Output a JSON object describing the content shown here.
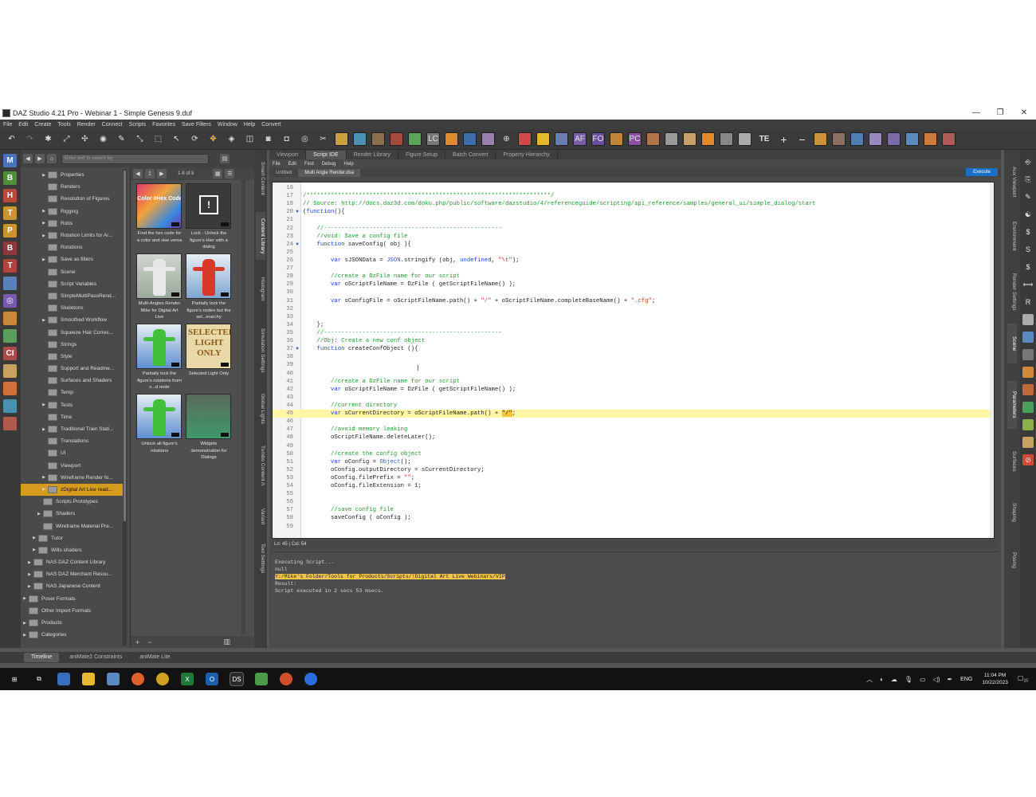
{
  "window": {
    "title": "DAZ Studio 4.21 Pro - Webinar 1 - Simple Genesis 9.duf"
  },
  "menu": [
    "File",
    "Edit",
    "Create",
    "Tools",
    "Render",
    "Connect",
    "Scripts",
    "Favorites",
    "Save Filters",
    "Window",
    "Help",
    "Convert"
  ],
  "toolbar_right": {
    "te_label": "TE"
  },
  "library": {
    "search_placeholder": "Enter text to search by",
    "page_label": "1",
    "count_label": "1-8 of 8",
    "tree": [
      {
        "label": "Properties",
        "arrow": "▶"
      },
      {
        "label": "Renders",
        "arrow": ""
      },
      {
        "label": "Resolution of Figures",
        "arrow": ""
      },
      {
        "label": "Rigging",
        "arrow": "▶"
      },
      {
        "label": "Robs",
        "arrow": "▶"
      },
      {
        "label": "Rotation Limits for Ar...",
        "arrow": "▶"
      },
      {
        "label": "Rotations",
        "arrow": ""
      },
      {
        "label": "Save as filters",
        "arrow": "▶"
      },
      {
        "label": "Scene",
        "arrow": ""
      },
      {
        "label": "Script Variables",
        "arrow": ""
      },
      {
        "label": "SimpleMultiPassRend...",
        "arrow": ""
      },
      {
        "label": "Skeletons",
        "arrow": ""
      },
      {
        "label": "Smoothed Workflow",
        "arrow": "▶"
      },
      {
        "label": "Squeeze Hair Correc...",
        "arrow": ""
      },
      {
        "label": "Strings",
        "arrow": ""
      },
      {
        "label": "Style",
        "arrow": ""
      },
      {
        "label": "Support and Readme...",
        "arrow": ""
      },
      {
        "label": "Surfaces and Shaders",
        "arrow": ""
      },
      {
        "label": "Temp",
        "arrow": ""
      },
      {
        "label": "Tests",
        "arrow": "▶"
      },
      {
        "label": "Time",
        "arrow": ""
      },
      {
        "label": "Traditional Train Stati...",
        "arrow": "▶"
      },
      {
        "label": "Translations",
        "arrow": ""
      },
      {
        "label": "UI",
        "arrow": ""
      },
      {
        "label": "Viewport",
        "arrow": ""
      },
      {
        "label": "Wireframe Render fo...",
        "arrow": "▶"
      },
      {
        "label": "zDigital Art Live read...",
        "arrow": "▶",
        "selected": true
      },
      {
        "label": "Scripts Prototypes",
        "arrow": ""
      },
      {
        "label": "Shaders",
        "arrow": "▶"
      },
      {
        "label": "Wireframe Material Pre...",
        "arrow": ""
      },
      {
        "label": "Tutor",
        "arrow": "▶"
      },
      {
        "label": "Wills shaders",
        "arrow": "▶"
      },
      {
        "label": "NAS DAZ Content Library",
        "arrow": "▶"
      },
      {
        "label": "NAS DAZ Merchant Resou...",
        "arrow": "▶"
      },
      {
        "label": "NAS Japanese Content",
        "arrow": "▶"
      },
      {
        "label": "Poser Formats",
        "arrow": "▶"
      },
      {
        "label": "Other Import Formats",
        "arrow": ""
      },
      {
        "label": "Products",
        "arrow": "▶"
      },
      {
        "label": "Categories",
        "arrow": "▶"
      }
    ],
    "tiles": [
      {
        "caption": "Find the hex code for a color and vise versa",
        "thumb_text": "Color #Hex Code",
        "kind": "hex"
      },
      {
        "caption": "Lock - Unlock the figure's Hier with a dialog",
        "thumb_text": "!",
        "kind": "lock"
      },
      {
        "caption": "Multi-Angles Render Mike for Digital Art Live",
        "thumb_text": "",
        "kind": "multi"
      },
      {
        "caption": "Partially lock the figure's nodes but the sel...erarchy",
        "thumb_text": "",
        "kind": "redfig"
      },
      {
        "caption": "Partially lock the figure's rotations from s...d node",
        "thumb_text": "",
        "kind": "greenfig"
      },
      {
        "caption": "Selected Light Only",
        "thumb_text": "SELECTED LIGHT ONLY",
        "kind": "light"
      },
      {
        "caption": "Unlock all figure's rotations",
        "thumb_text": "",
        "kind": "greenfig2"
      },
      {
        "caption": "Widgets demonstration for Dialogs",
        "thumb_text": "",
        "kind": "widgets"
      }
    ]
  },
  "side_tabs_left": [
    "Smart Content",
    "Content Library",
    "Histogram",
    "Simulation Settings",
    "Global Lights",
    "Tumbo Content A",
    "Variant",
    "Tool Settings"
  ],
  "side_tabs_right": [
    "Aux Viewport",
    "Environment",
    "Render Settings",
    "Scene",
    "Parameters",
    "Surfaces",
    "Shaping",
    "Posing"
  ],
  "view_tabs": [
    "Viewport",
    "Script IDE",
    "Render Library",
    "Figure Setup",
    "Batch Convert",
    "Property Hierarchy"
  ],
  "ide": {
    "menu": [
      "File",
      "Edit",
      "Find",
      "Debug",
      "Help"
    ],
    "file_tabs": [
      "Untitled",
      "Multi Angle Render.dsa"
    ],
    "execute_label": "Execute",
    "status": "Ln: 45  |  Col: 54",
    "lines": [
      {
        "n": "16",
        "t": ""
      },
      {
        "n": "17",
        "t": "/**********************************************************************/"
      },
      {
        "n": "18",
        "t": "// Source: http://docs.daz3d.com/doku.php/public/software/dazstudio/4/referenceguide/scripting/api_reference/samples/general_ui/simple_dialog/start"
      },
      {
        "n": "20",
        "t": "(function(){",
        "fold": "▼"
      },
      {
        "n": "21",
        "t": ""
      },
      {
        "n": "22",
        "t": "    //---------------------------------------------------"
      },
      {
        "n": "23",
        "t": "    //void: Save a config file"
      },
      {
        "n": "24",
        "t": "    function saveConfig( obj ){",
        "fold": "▼"
      },
      {
        "n": "25",
        "t": ""
      },
      {
        "n": "26",
        "t": "        var sJSONData = JSON.stringify (obj, undefined, \"\\t\");"
      },
      {
        "n": "27",
        "t": ""
      },
      {
        "n": "28",
        "t": "        //create a DzFile name for our script"
      },
      {
        "n": "29",
        "t": "        var oScriptFileName = DzFile ( getScriptFileName() );"
      },
      {
        "n": "30",
        "t": ""
      },
      {
        "n": "31",
        "t": "        var sConfigFile = oScriptFileName.path() + \"/\" + oScriptFileName.completeBaseName() + \".cfg\";"
      },
      {
        "n": "32",
        "t": ""
      },
      {
        "n": "33",
        "t": ""
      },
      {
        "n": "34",
        "t": "    };"
      },
      {
        "n": "35",
        "t": "    //---------------------------------------------------"
      },
      {
        "n": "36",
        "t": "    //Obj: Create a new conf object"
      },
      {
        "n": "37",
        "t": "    function createConfObject (){",
        "fold": "▼"
      },
      {
        "n": "38",
        "t": ""
      },
      {
        "n": "39",
        "t": ""
      },
      {
        "n": "40",
        "t": ""
      },
      {
        "n": "41",
        "t": "        //create a DzFile name for our script"
      },
      {
        "n": "42",
        "t": "        var oScriptFileName = DzFile ( getScriptFileName() );"
      },
      {
        "n": "43",
        "t": ""
      },
      {
        "n": "44",
        "t": "        //current directory"
      },
      {
        "n": "45",
        "t": "        var sCurrentDirectory = oScriptFileName.path() + \"/\";",
        "hl": true
      },
      {
        "n": "46",
        "t": ""
      },
      {
        "n": "47",
        "t": "        //avoid memory leaking"
      },
      {
        "n": "48",
        "t": "        oScriptFileName.deleteLater();"
      },
      {
        "n": "49",
        "t": ""
      },
      {
        "n": "50",
        "t": "        //create the config object"
      },
      {
        "n": "51",
        "t": "        var oConfig = Object();"
      },
      {
        "n": "52",
        "t": "        oConfig.outputDirectory = sCurrentDirectory;"
      },
      {
        "n": "53",
        "t": "        oConfig.filePrefix = \"\";"
      },
      {
        "n": "54",
        "t": "        oConfig.fileExtension = 1;"
      },
      {
        "n": "55",
        "t": ""
      },
      {
        "n": "56",
        "t": ""
      },
      {
        "n": "57",
        "t": "        //save config file"
      },
      {
        "n": "58",
        "t": "        saveConfig ( oConfig );"
      },
      {
        "n": "59",
        "t": ""
      }
    ],
    "output": [
      {
        "t": "Executing Script..."
      },
      {
        "t": "null"
      },
      {
        "t": "Y:/Mike's Folder/Tools for Products/Scripts/!Digital Art Live Webinars/VIP",
        "path": true
      },
      {
        "t": "Result:"
      },
      {
        "t": "Script executed in 2 secs 53 msecs."
      }
    ]
  },
  "timeline_tabs": [
    "Timeline",
    "aniMate2 Constraints",
    "aniMate Lite"
  ],
  "taskbar": {
    "lang": "ENG",
    "time": "11:04 PM",
    "date": "10/22/2023",
    "notif": "15"
  },
  "colors": {
    "accent_selected": "#d49b1d",
    "execute": "#1a6fc9",
    "comment": "#1f9a2b",
    "keyword": "#1f3fd0",
    "string": "#b53a17"
  }
}
